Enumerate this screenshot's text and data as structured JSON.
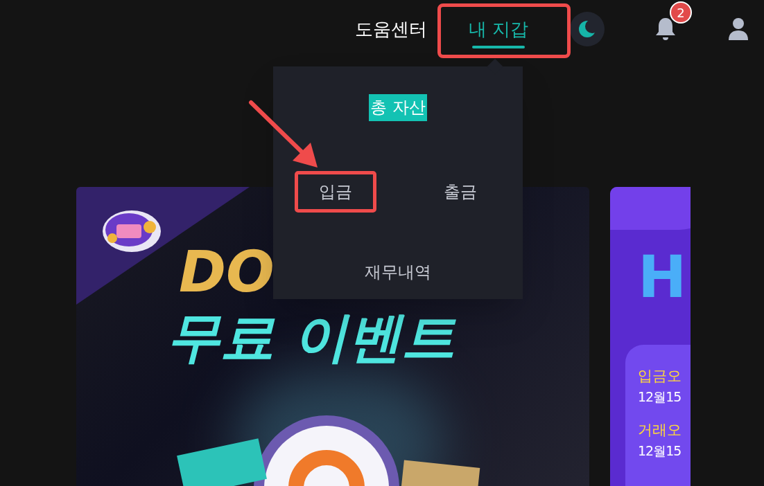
{
  "nav": {
    "links": [
      {
        "label": "도움센터",
        "selected": false
      },
      {
        "label": "내 지갑",
        "selected": true
      }
    ],
    "notifications": {
      "count": "2"
    }
  },
  "wallet_menu": {
    "title": "총 자산",
    "items": [
      {
        "label": "입금",
        "highlighted": true
      },
      {
        "label": "출금",
        "highlighted": false
      },
      {
        "label": "재무내역",
        "highlighted": false
      }
    ]
  },
  "banners": [
    {
      "kind": "event",
      "headline_1": "DO",
      "headline_2": "무료 이벤트"
    },
    {
      "kind": "schedule",
      "headline": "H",
      "lines": [
        {
          "label": "입금오",
          "date": "12월15"
        },
        {
          "label": "거래오",
          "date": "12월15"
        }
      ]
    }
  ]
}
